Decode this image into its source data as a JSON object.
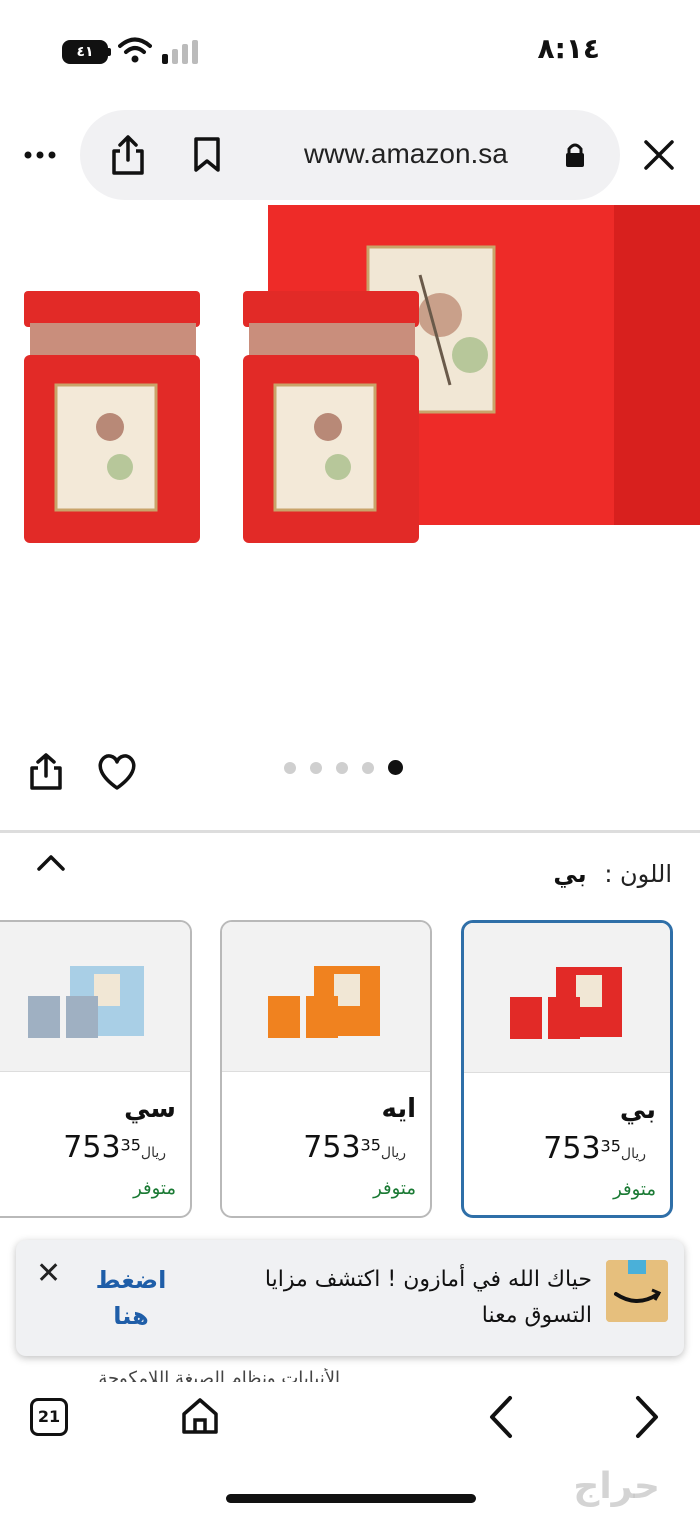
{
  "status": {
    "time": "٨:١٤",
    "battery": "٤١"
  },
  "browser": {
    "url": "www.amazon.sa",
    "tab_count": "21"
  },
  "gallery": {
    "dot_count": 5,
    "active_dot": 4
  },
  "color_select": {
    "label": "اللون :",
    "value": "بي"
  },
  "variants": [
    {
      "name": "بي",
      "price_whole": "753",
      "price_frac": "35",
      "currency": "ريال",
      "stock": "متوفر",
      "color": "#e22a27",
      "selected": true
    },
    {
      "name": "ايه",
      "price_whole": "753",
      "price_frac": "35",
      "currency": "ريال",
      "stock": "متوفر",
      "color": "#f0821f",
      "selected": false
    },
    {
      "name": "سي",
      "price_whole": "753",
      "price_frac": "35",
      "currency": "ريال",
      "stock": "متوفر",
      "color": "#a9cfe6",
      "selected": false
    }
  ],
  "banner": {
    "text": "حياك الله في أمازون ! اكتشف مزايا التسوق معنا",
    "cta": "اضغط هنا",
    "close": "✕"
  },
  "cutoff": "الأنيابات ونظام الصيغة اللامكوجة",
  "watermark": "حراج",
  "colors": {
    "accent": "#2f6fa8",
    "in_stock": "#1a7a34",
    "product_red": "#e22a27"
  }
}
